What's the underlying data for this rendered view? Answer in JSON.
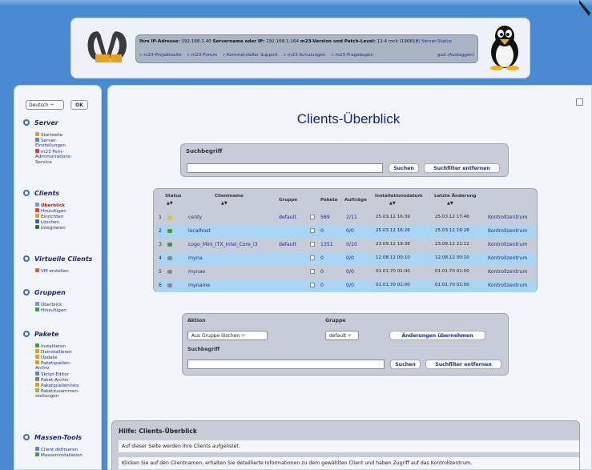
{
  "header": {
    "info_ip_label": "Ihre IP-Adresse:",
    "info_ip": "192.168.1.40",
    "info_server_label": "Servername oder IP:",
    "info_server": "192.168.1.164",
    "info_version_label": "m23-Version und Patch-Level:",
    "info_version": "12.4 rock (190618)",
    "info_status": "Server-Status",
    "links": [
      "» m23-Projektseite",
      "» m23-Forum",
      "» Kommerzieller Support",
      "» m23-Schulungen",
      "» m23-Fragebogen"
    ],
    "logout": "god (Ausloggen)"
  },
  "sidebar": {
    "language": "Deutsch ÷",
    "ok": "OK",
    "sections": [
      {
        "title": "Server",
        "items": [
          {
            "label": "Startseite",
            "color": "#e0a020"
          },
          {
            "label": "Server-",
            "color": "#6080d0"
          },
          {
            "label": "Einstellungen",
            "color": ""
          },
          {
            "label": "m23 Fern-",
            "color": "#d04040"
          },
          {
            "label": "Administrations-",
            "color": ""
          },
          {
            "label": "Service",
            "color": ""
          }
        ]
      },
      {
        "title": "Clients",
        "items": [
          {
            "label": "Überblick",
            "color": "#60a0e0",
            "active": true
          },
          {
            "label": "Hinzufügen",
            "color": "#e04040"
          },
          {
            "label": "Einrichten",
            "color": "#e0a020"
          },
          {
            "label": "Löschen",
            "color": "#4060c0"
          },
          {
            "label": "Integrieren",
            "color": "#208020"
          }
        ]
      },
      {
        "title": "Virtuelle Clients",
        "items": [
          {
            "label": "VM erstellen",
            "color": "#e06030"
          }
        ]
      },
      {
        "title": "Gruppen",
        "items": [
          {
            "label": "Überblick",
            "color": "#60a0e0"
          },
          {
            "label": "Hinzufügen",
            "color": "#40a040"
          }
        ]
      },
      {
        "title": "Pakete",
        "items": [
          {
            "label": "Installieren",
            "color": "#40a040"
          },
          {
            "label": "Deinstallieren",
            "color": "#e0a020"
          },
          {
            "label": "Update",
            "color": "#e0a020"
          },
          {
            "label": "Paketquellen-",
            "color": "#d0a030"
          },
          {
            "label": "Archiv",
            "color": ""
          },
          {
            "label": "Skript-Editor",
            "color": "#6080d0"
          },
          {
            "label": "Paket-Archiv",
            "color": "#808080"
          },
          {
            "label": "Paketquellenliste",
            "color": "#e0a020"
          },
          {
            "label": "Paketzusammen-",
            "color": "#90c040"
          },
          {
            "label": "stellungen",
            "color": ""
          }
        ]
      },
      {
        "title": "Massen-Tools",
        "items": [
          {
            "label": "Client definieren",
            "color": "#6080d0"
          },
          {
            "label": "Masseninstallation",
            "color": "#40a040"
          }
        ]
      }
    ]
  },
  "main": {
    "title": "Clients-Überblick",
    "search": {
      "label": "Suchbegriff",
      "search_btn": "Suchen",
      "clear_btn": "Suchfilter entfernen"
    },
    "table": {
      "headers": {
        "status": "Status",
        "clientname": "Clientname",
        "group": "Gruppe",
        "packages": "Pakete",
        "jobs": "Aufträge",
        "install_date": "Installationsdatum",
        "last_change": "Letzte Änderung"
      },
      "action_label": "Kontrollzentrum",
      "rows": [
        {
          "num": "1",
          "status": "yellow",
          "name": "centy",
          "group": "default",
          "packages": "589",
          "jobs": "2/11",
          "install": "25.03.12 16:39",
          "changed": "25.03.12 17:46"
        },
        {
          "num": "2",
          "status": "green",
          "name": "localhost",
          "group": "",
          "packages": "0",
          "jobs": "0/0",
          "install": "25.03.12 16:26",
          "changed": "25.03.12 16:26"
        },
        {
          "num": "3",
          "status": "green",
          "name": "Logo_Mini_ITX_Intel_Core_i3",
          "group": "default",
          "packages": "1351",
          "jobs": "0/10",
          "install": "23.09.12 19:38",
          "changed": "23.09.12 21:12"
        },
        {
          "num": "4",
          "status": "gray",
          "name": "myna",
          "group": "",
          "packages": "0",
          "jobs": "0/0",
          "install": "12.08.12 00:10",
          "changed": "12.08.12 00:10"
        },
        {
          "num": "5",
          "status": "gray",
          "name": "mynae",
          "group": "",
          "packages": "0",
          "jobs": "0/0",
          "install": "01.01.70 01:00",
          "changed": "01.01.70 01:00"
        },
        {
          "num": "6",
          "status": "gray",
          "name": "myname",
          "group": "",
          "packages": "0",
          "jobs": "0/0",
          "install": "01.01.70 01:00",
          "changed": "01.01.70 01:00"
        }
      ]
    },
    "actions": {
      "action_label": "Aktion",
      "action_value": "Aus Gruppe löschen ÷",
      "group_label": "Gruppe",
      "group_value": "default ÷",
      "apply_btn": "Änderungen übernehmen",
      "search_label": "Suchbegriff",
      "search_btn": "Suchen",
      "clear_btn": "Suchfilter entfernen"
    },
    "help": {
      "title": "Hilfe: Clients-Überblick",
      "line1": "Auf dieser Seite werden Ihre Clients aufgelistet.",
      "line2": "Klicken Sie auf den Clientnamen, erhalten Sie detaillierte Informationen zu dem gewählten Client und haben Zugriff auf das Kontrollzentrum."
    }
  },
  "colors": {
    "status_yellow": "#e8c020",
    "status_green": "#30a030",
    "status_gray": "#8a8a8a"
  }
}
